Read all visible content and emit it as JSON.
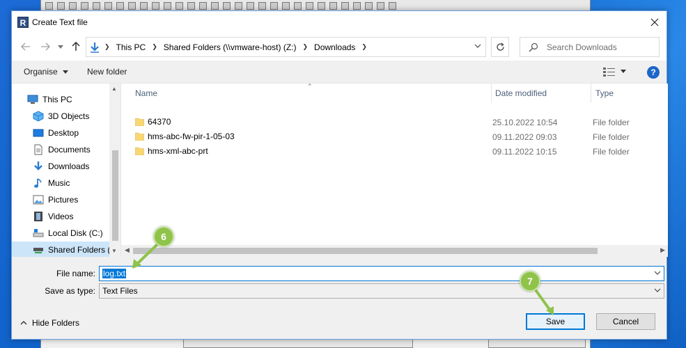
{
  "dialog": {
    "title": "Create Text file",
    "app_icon_letter": "R"
  },
  "address_bar": {
    "crumbs": [
      "This PC",
      "Shared Folders (\\\\vmware-host) (Z:)",
      "Downloads"
    ]
  },
  "search": {
    "placeholder": "Search Downloads"
  },
  "commands": {
    "organise": "Organise",
    "new_folder": "New folder",
    "help": "?"
  },
  "nav_pane": {
    "items": [
      {
        "label": "This PC",
        "icon": "computer-icon"
      },
      {
        "label": "3D Objects",
        "icon": "cube-icon"
      },
      {
        "label": "Desktop",
        "icon": "desktop-icon"
      },
      {
        "label": "Documents",
        "icon": "document-icon"
      },
      {
        "label": "Downloads",
        "icon": "download-arrow-icon"
      },
      {
        "label": "Music",
        "icon": "music-note-icon"
      },
      {
        "label": "Pictures",
        "icon": "picture-icon"
      },
      {
        "label": "Videos",
        "icon": "film-icon"
      },
      {
        "label": "Local Disk (C:)",
        "icon": "disk-icon"
      },
      {
        "label": "Shared Folders (\\",
        "icon": "network-drive-icon"
      }
    ],
    "selected_index": 9
  },
  "columns": {
    "name": "Name",
    "date": "Date modified",
    "type": "Type"
  },
  "files": [
    {
      "name": "64370",
      "date": "25.10.2022 10:54",
      "type": "File folder"
    },
    {
      "name": "hms-abc-fw-pir-1-05-03",
      "date": "09.11.2022 09:03",
      "type": "File folder"
    },
    {
      "name": "hms-xml-abc-prt",
      "date": "09.11.2022 10:15",
      "type": "File folder"
    }
  ],
  "form": {
    "file_name_label": "File name:",
    "file_name_value": "log.txt",
    "save_type_label": "Save as type:",
    "save_type_value": "Text Files"
  },
  "buttons": {
    "hide_folders": "Hide Folders",
    "save": "Save",
    "cancel": "Cancel"
  },
  "annotations": {
    "step_a": "6",
    "step_b": "7",
    "color": "#8fc34a"
  },
  "colors": {
    "accent": "#0078d7",
    "selection": "#cde5f9",
    "folder": "#f8d775"
  }
}
